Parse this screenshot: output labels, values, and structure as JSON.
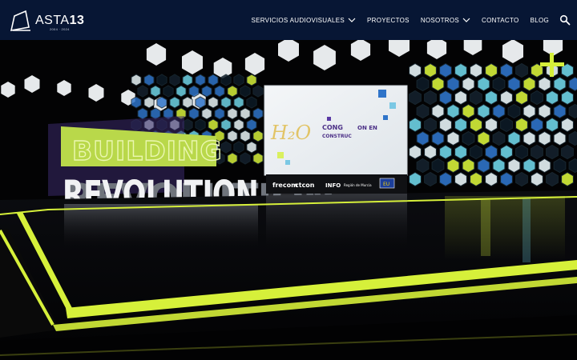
{
  "brand": {
    "name_light": "ASTA",
    "name_bold": "13",
    "years": "2004 · 2024"
  },
  "nav": {
    "items": [
      {
        "label": "SERVICIOS AUDIOVISUALES",
        "has_dropdown": true
      },
      {
        "label": "PROYECTOS",
        "has_dropdown": false
      },
      {
        "label": "NOSOTROS",
        "has_dropdown": true
      },
      {
        "label": "CONTACTO",
        "has_dropdown": false
      },
      {
        "label": "BLOG",
        "has_dropdown": false
      }
    ],
    "search_icon": "search-icon"
  },
  "hero": {
    "sign_top": "BUILDING",
    "sign_bottom": "REVOLUTION",
    "screen_mark": "H₂O",
    "screen_line1": "CONG",
    "screen_line2": "ON EN",
    "screen_line3": "CONSTRUC",
    "sponsors": [
      "frecom",
      "ctcon",
      "INFO",
      "Región de Murcia",
      "EU"
    ]
  },
  "colors": {
    "header_bg": "#071634",
    "accent_lime": "#d6f03a",
    "hex_blue": "#2f74c9",
    "hex_cyan": "#6ed3e6",
    "hex_white": "#e8f4f7",
    "stage_bg": "#050507"
  }
}
